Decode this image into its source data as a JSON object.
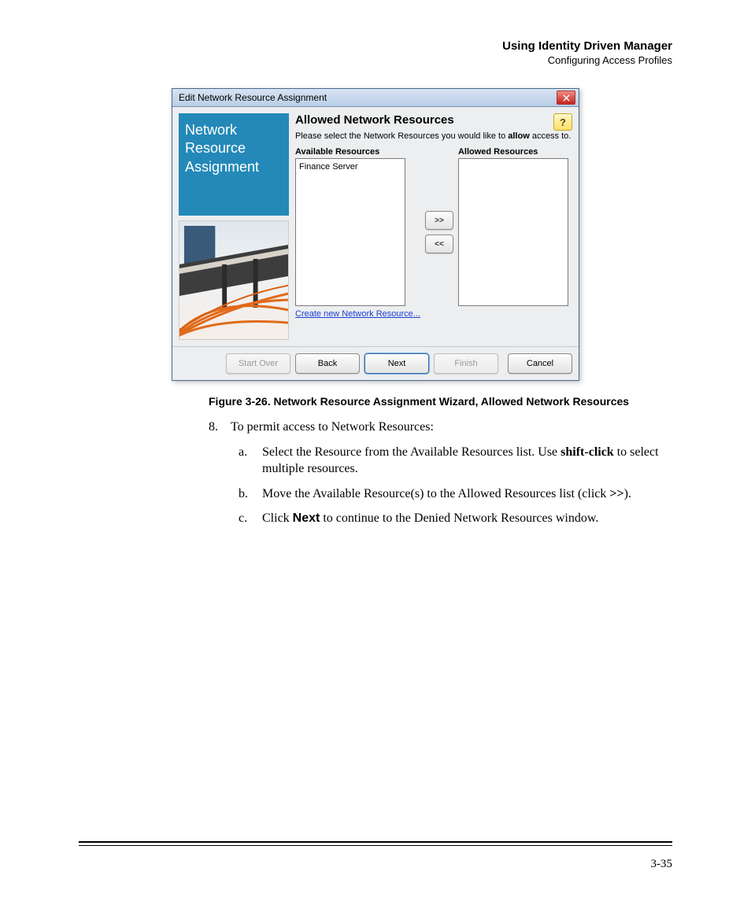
{
  "header": {
    "title": "Using Identity Driven Manager",
    "subtitle": "Configuring Access Profiles"
  },
  "dialog": {
    "title": "Edit Network Resource Assignment",
    "side_label": "Network Resource Assignment",
    "main_heading": "Allowed Network Resources",
    "help_glyph": "?",
    "instruction_pre": "Please select the Network Resources you would like to ",
    "instruction_bold": "allow",
    "instruction_post": " access to.",
    "available_label": "Available Resources",
    "allowed_label": "Allowed Resources",
    "available_items": [
      "Finance Server"
    ],
    "allowed_items": [],
    "move_right_label": ">>",
    "move_left_label": "<<",
    "create_link": "Create new Network Resource...",
    "buttons": {
      "start_over": "Start Over",
      "back": "Back",
      "next": "Next",
      "finish": "Finish",
      "cancel": "Cancel"
    }
  },
  "caption": "Figure 3-26. Network Resource Assignment Wizard, Allowed Network Resources",
  "step": {
    "number": "8.",
    "text": "To permit access to Network Resources:",
    "a": {
      "letter": "a.",
      "pre": "Select the Resource from the Available Resources list. Use ",
      "bold": "shift-click",
      "post": " to select multiple resources."
    },
    "b": {
      "letter": "b.",
      "pre": "Move the Available Resource(s) to the Allowed Resources list (click ",
      "bold": ">>",
      "post": ")."
    },
    "c": {
      "letter": "c.",
      "pre": "Click ",
      "bold": "Next",
      "post": " to continue to the Denied Network Resources window."
    }
  },
  "page_number": "3-35"
}
